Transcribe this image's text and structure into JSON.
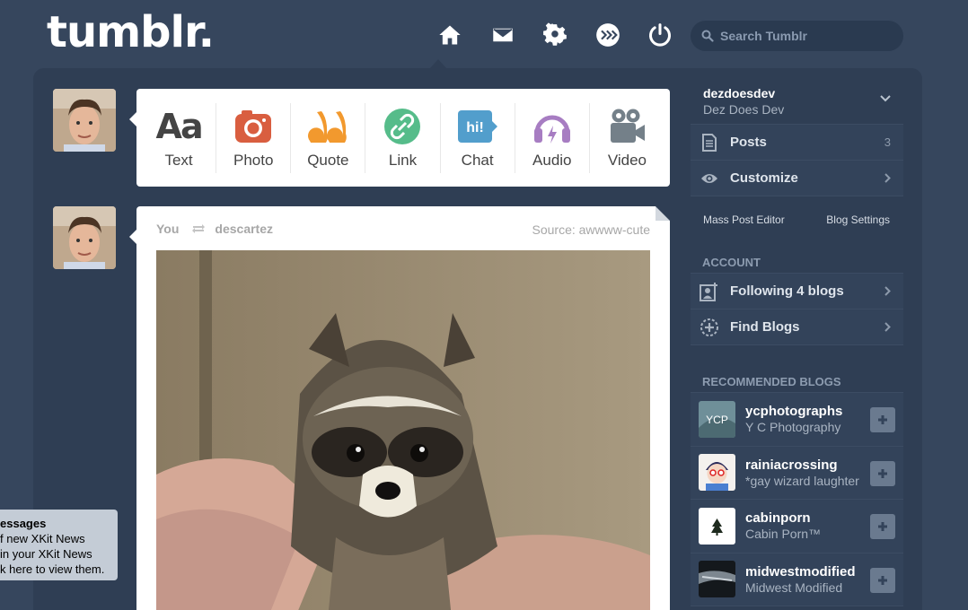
{
  "header": {
    "logo": "tumblr.",
    "search_placeholder": "Search Tumblr"
  },
  "post_types": [
    {
      "label": "Text",
      "icon": "text-icon",
      "color": "#444444"
    },
    {
      "label": "Photo",
      "icon": "camera-icon",
      "color": "#d95e40"
    },
    {
      "label": "Quote",
      "icon": "quote-icon",
      "color": "#f2992e"
    },
    {
      "label": "Link",
      "icon": "link-icon",
      "color": "#56bc8a"
    },
    {
      "label": "Chat",
      "icon": "chat-icon",
      "color": "#529ecc"
    },
    {
      "label": "Audio",
      "icon": "headphones-icon",
      "color": "#a77dc2"
    },
    {
      "label": "Video",
      "icon": "video-camera-icon",
      "color": "#748089"
    }
  ],
  "post": {
    "author": "You",
    "reblogged_from": "descartez",
    "source_label": "Source:",
    "source_name": "awwww-cute"
  },
  "sidebar": {
    "blog_name": "dezdoesdev",
    "blog_title": "Dez Does Dev",
    "posts_label": "Posts",
    "posts_count": "3",
    "customize_label": "Customize",
    "mass_post_editor": "Mass Post Editor",
    "blog_settings": "Blog Settings",
    "account_header": "ACCOUNT",
    "following_label": "Following 4 blogs",
    "find_blogs_label": "Find Blogs",
    "recommended_header": "RECOMMENDED BLOGS",
    "recommended": [
      {
        "name": "ycphotographs",
        "title": "Y C Photography",
        "avatar_text": "YCP"
      },
      {
        "name": "rainiacrossing",
        "title": "*gay wizard laughter",
        "avatar_text": ""
      },
      {
        "name": "cabinporn",
        "title": "Cabin Porn™",
        "avatar_text": ""
      },
      {
        "name": "midwestmodified",
        "title": "Midwest Modified",
        "avatar_text": ""
      }
    ]
  },
  "xkit_toast": {
    "title": "essages",
    "line1": "f new XKit News",
    "line2": "in your XKit News",
    "line3": "k here to view them."
  }
}
